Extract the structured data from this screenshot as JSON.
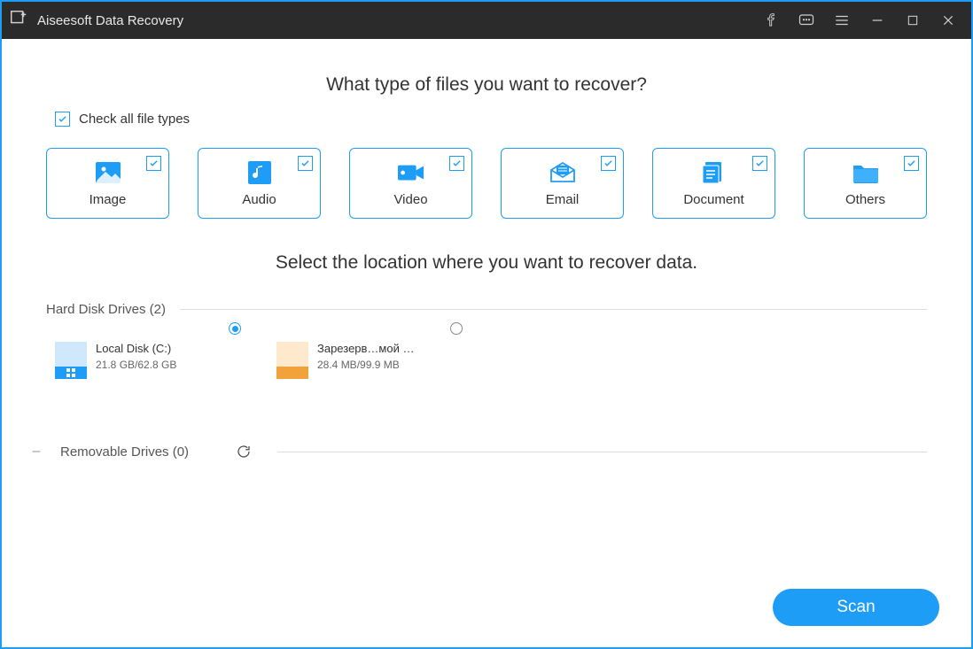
{
  "app": {
    "title": "Aiseesoft Data Recovery"
  },
  "headings": {
    "filetypes": "What type of files you want to recover?",
    "location": "Select the location where you want to recover data."
  },
  "check_all": {
    "label": "Check all file types",
    "checked": true
  },
  "filetypes": [
    {
      "key": "image",
      "label": "Image",
      "checked": true
    },
    {
      "key": "audio",
      "label": "Audio",
      "checked": true
    },
    {
      "key": "video",
      "label": "Video",
      "checked": true
    },
    {
      "key": "email",
      "label": "Email",
      "checked": true
    },
    {
      "key": "document",
      "label": "Document",
      "checked": true
    },
    {
      "key": "others",
      "label": "Others",
      "checked": true
    }
  ],
  "sections": {
    "hdd": {
      "title": "Hard Disk Drives (2)"
    },
    "removable": {
      "title": "Removable Drives (0)"
    }
  },
  "drives": [
    {
      "name": "Local Disk (C:)",
      "size": "21.8 GB/62.8 GB",
      "selected": true,
      "color_top": "#cfe8fb",
      "color_bottom": "#1e9df7"
    },
    {
      "name": "Зарезерв…мой (*:)",
      "size": "28.4 MB/99.9 MB",
      "selected": false,
      "color_top": "#ffe9cc",
      "color_bottom": "#f2a23a"
    }
  ],
  "buttons": {
    "scan": "Scan"
  }
}
